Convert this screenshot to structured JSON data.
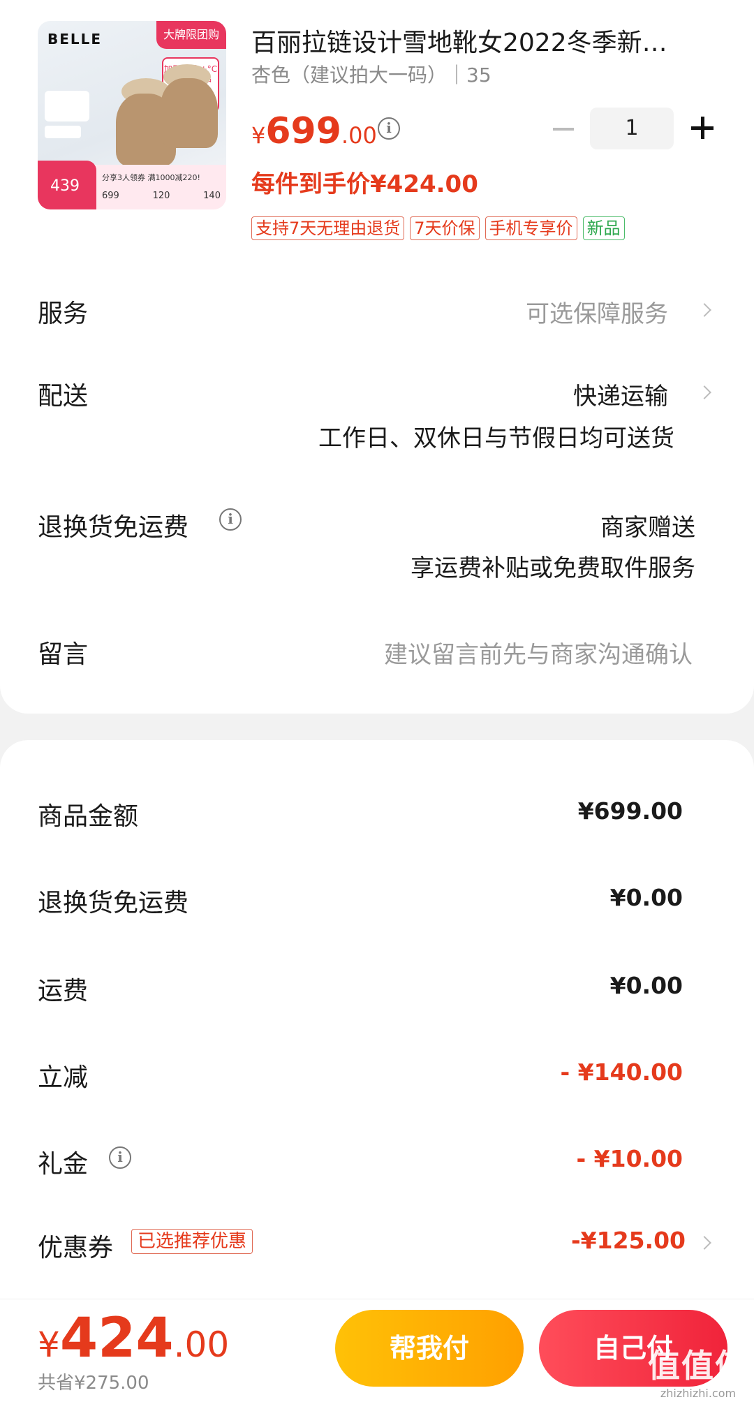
{
  "product": {
    "image": {
      "brand": "BELLE",
      "ribbon": "大牌限团购",
      "tag": "加厚毛里 +°C 温暖小暖护",
      "price_tag": "439",
      "strip_text": "分享3人领券 满1000减220!",
      "strip_prices": [
        "699",
        "120",
        "140"
      ]
    },
    "title": "百丽拉链设计雪地靴女2022冬季新…",
    "spec": "杏色（建议拍大一码）｜35",
    "price": {
      "currency": "¥",
      "integer": "699",
      "decimal": ".00"
    },
    "quantity": "1",
    "per_unit_price": "每件到手价¥424.00",
    "badges": [
      "支持7天无理由退货",
      "7天价保",
      "手机专享价",
      "新品"
    ]
  },
  "service": {
    "label": "服务",
    "value": "可选保障服务"
  },
  "delivery": {
    "label": "配送",
    "value": "快递运输",
    "note": "工作日、双休日与节假日均可送货"
  },
  "return_shipping": {
    "label": "退换货免运费",
    "value": "商家赠送",
    "note": "享运费补贴或免费取件服务"
  },
  "message": {
    "label": "留言",
    "placeholder": "建议留言前先与商家沟通确认"
  },
  "summary": {
    "items": [
      {
        "label": "商品金额",
        "value": "¥699.00"
      },
      {
        "label": "退换货免运费",
        "value": "¥0.00"
      },
      {
        "label": "运费",
        "value": "¥0.00"
      },
      {
        "label": "立减",
        "value": "- ¥140.00"
      },
      {
        "label": "礼金",
        "value": "- ¥10.00"
      },
      {
        "label": "优惠券",
        "value": "-¥125.00",
        "tag": "已选推荐优惠"
      }
    ]
  },
  "footer": {
    "total": {
      "currency": "¥",
      "integer": "424",
      "decimal": ".00"
    },
    "saved": "共省¥275.00",
    "help_pay": "帮我付",
    "self_pay": "自己付",
    "watermark": "值值值",
    "watermark_url": "zhizhizhi.com"
  },
  "colors": {
    "accent": "#e53a1c",
    "help_btn": "#ffb300",
    "self_btn": "#f5313f",
    "badge_green": "#2fa84f"
  }
}
